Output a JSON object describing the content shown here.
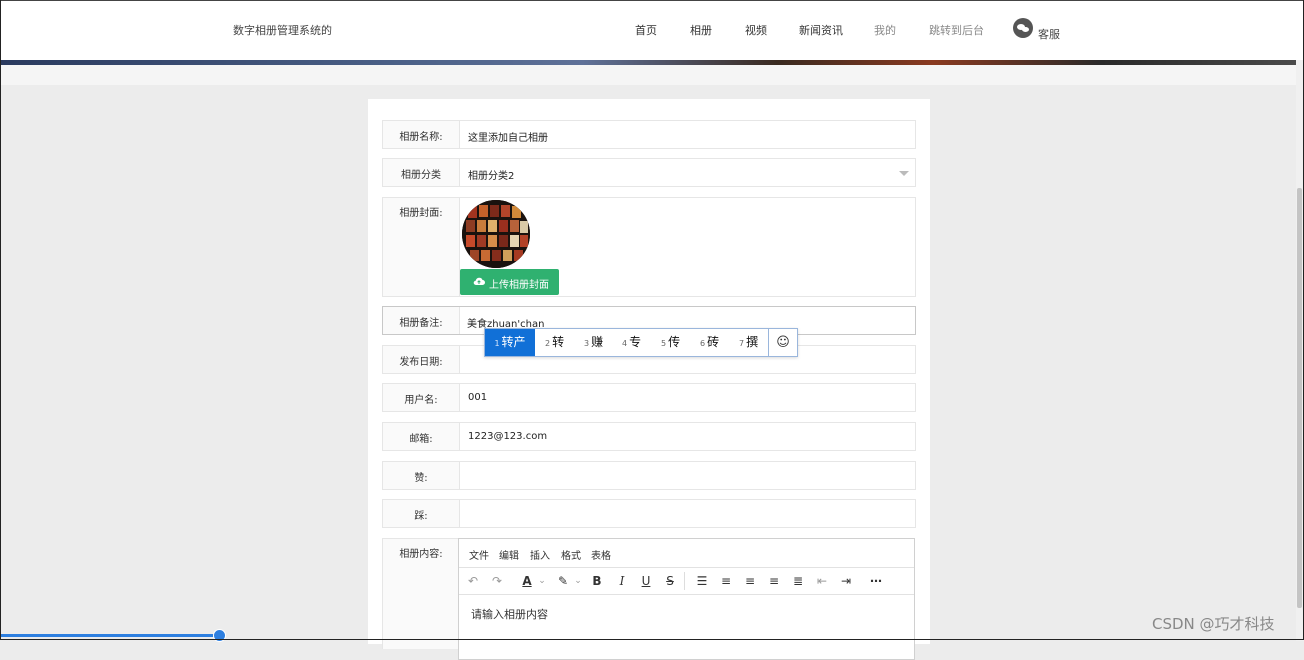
{
  "header": {
    "site_title": "数字相册管理系统的",
    "nav": [
      "首页",
      "相册",
      "视频",
      "新闻资讯",
      "我的",
      "跳转到后台"
    ],
    "service": "客服"
  },
  "form": {
    "name": {
      "label": "相册名称:",
      "value": "这里添加自己相册"
    },
    "category": {
      "label": "相册分类",
      "value": "相册分类2"
    },
    "cover": {
      "label": "相册封面:",
      "upload_label": "上传相册封面"
    },
    "remark": {
      "label": "相册备注:",
      "value": "美食zhuan'chan"
    },
    "publish_date": {
      "label": "发布日期:",
      "value": ""
    },
    "username": {
      "label": "用户名:",
      "value": "001"
    },
    "email": {
      "label": "邮箱:",
      "value": "1223@123.com"
    },
    "like": {
      "label": "赞:",
      "value": ""
    },
    "dislike": {
      "label": "踩:",
      "value": ""
    },
    "content": {
      "label": "相册内容:"
    }
  },
  "ime": {
    "candidates": [
      {
        "num": "1",
        "text": "转产"
      },
      {
        "num": "2",
        "text": "转"
      },
      {
        "num": "3",
        "text": "赚"
      },
      {
        "num": "4",
        "text": "专"
      },
      {
        "num": "5",
        "text": "传"
      },
      {
        "num": "6",
        "text": "砖"
      },
      {
        "num": "7",
        "text": "撰"
      }
    ],
    "selected_index": 0,
    "emoji_icon": "smiley-icon"
  },
  "editor": {
    "menu": [
      "文件",
      "编辑",
      "插入",
      "格式",
      "表格"
    ],
    "placeholder": "请输入相册内容",
    "toolbar_icons": [
      "undo-icon",
      "redo-icon",
      "text-color-icon",
      "highlight-icon",
      "bold-icon",
      "italic-icon",
      "underline-icon",
      "strikethrough-icon",
      "line-height-icon",
      "align-left-icon",
      "align-center-icon",
      "align-right-icon",
      "align-justify-icon",
      "outdent-icon",
      "indent-icon",
      "more-icon"
    ]
  },
  "watermark": "CSDN @巧才科技",
  "colors": {
    "accent_green": "#2fb170",
    "ime_blue": "#1170d7"
  }
}
